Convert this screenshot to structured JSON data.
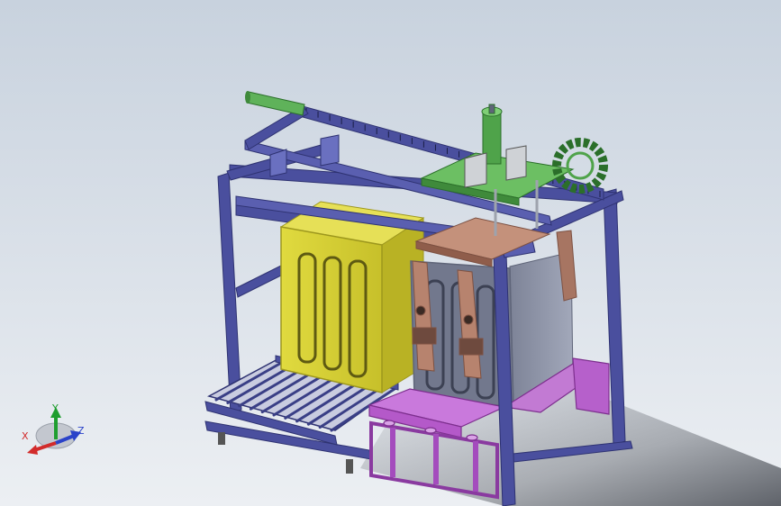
{
  "viewport": {
    "background_top": "#c8d2de",
    "background_bottom": "#eceff3"
  },
  "colors": {
    "frame": "#4a4f9e",
    "frame_dark": "#2f3372",
    "frame_light": "#6a70c0",
    "yellow_box": "#d6cf33",
    "yellow_dark": "#9d971d",
    "grey_box": "#8f95a8",
    "grey_dark": "#5f6579",
    "magenta": "#b459c9",
    "magenta_dark": "#7d2f8e",
    "green": "#4fa34a",
    "green_dark": "#2b6f2a",
    "copper": "#b7836e",
    "copper_dark": "#7d5142",
    "roller": "#7a83b0",
    "shadow": "#30343c"
  },
  "triad": {
    "x_label": "X",
    "y_label": "Y",
    "z_label": "Z",
    "x_color": "#d22b2b",
    "y_color": "#1f9e2f",
    "z_color": "#2b43c9"
  }
}
